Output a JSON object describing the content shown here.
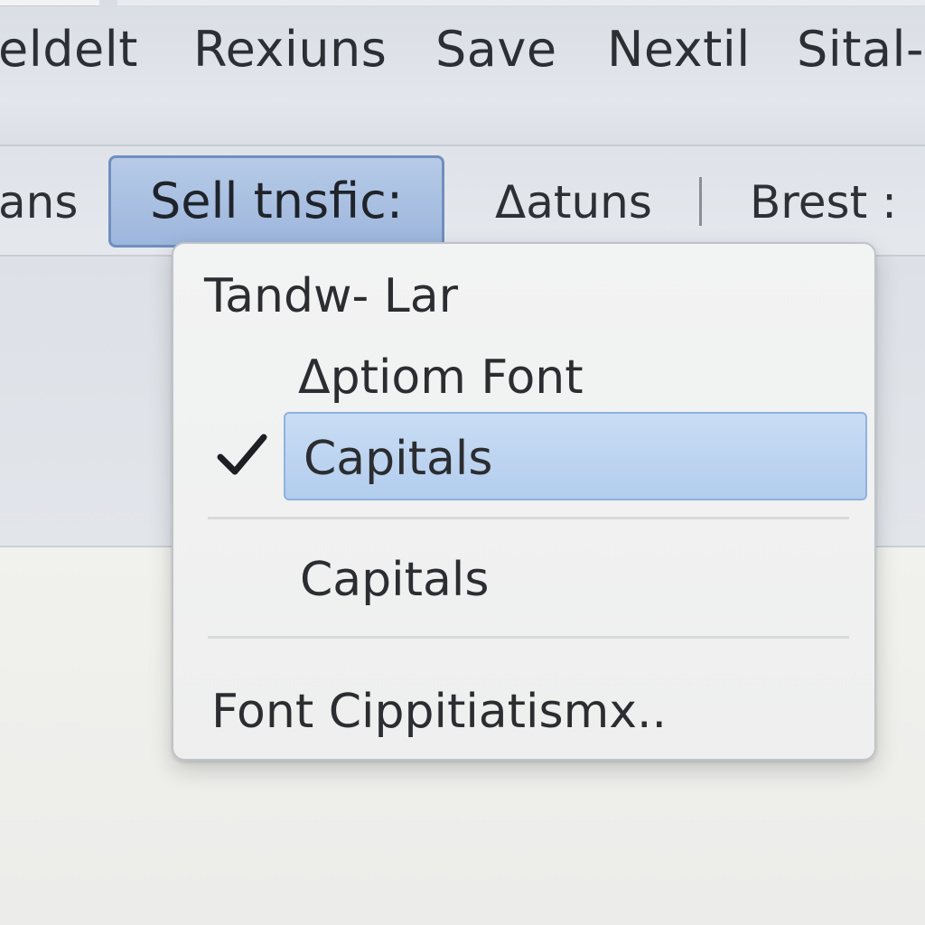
{
  "menubar": {
    "items": [
      "eldelt",
      "Rexiuns",
      "Save",
      "Nextil",
      "Sital-"
    ]
  },
  "toolbar": {
    "tabs": {
      "left_partial": "ans",
      "active": "Sell tnsfic:",
      "datuns": "Δatuns",
      "brest": "Brest :"
    }
  },
  "dropdown": {
    "header": "Tandw- Lar",
    "option_font": "Δptiom Font",
    "selected": "Capitals",
    "item_capitals": "Capitals",
    "footer": "Font Cippitiatismx..",
    "check_icon": "checkmark-icon"
  },
  "colors": {
    "highlight": "#b3cdee",
    "active_tab": "#9db6dc",
    "accent_border": "#6f8fbf"
  }
}
